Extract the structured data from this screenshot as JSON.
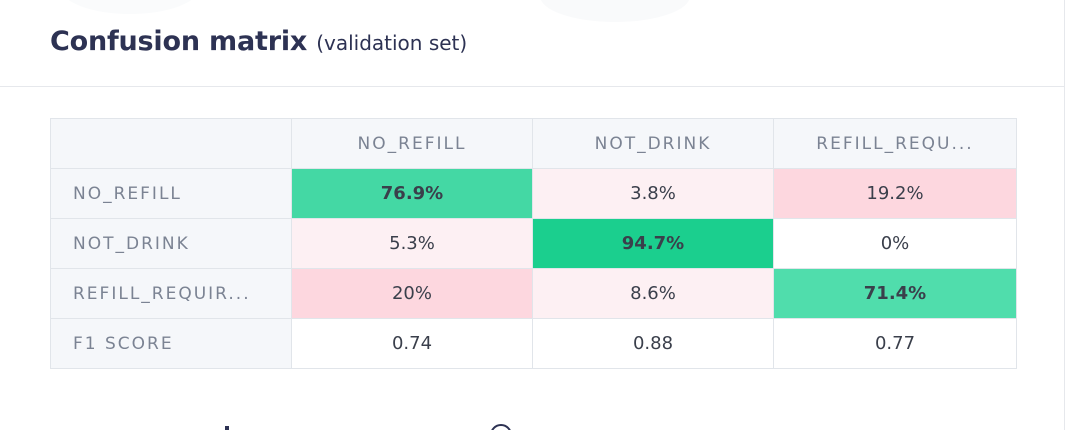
{
  "header": {
    "title": "Confusion matrix",
    "subtitle": "(validation set)"
  },
  "matrix": {
    "columns": [
      "NO_REFILL",
      "NOT_DRINK",
      "REFILL_REQU..."
    ],
    "rows": [
      {
        "label": "NO_REFILL",
        "cells": [
          "76.9%",
          "3.8%",
          "19.2%"
        ]
      },
      {
        "label": "NOT_DRINK",
        "cells": [
          "5.3%",
          "94.7%",
          "0%"
        ]
      },
      {
        "label": "REFILL_REQUIR...",
        "cells": [
          "20%",
          "8.6%",
          "71.4%"
        ]
      }
    ],
    "f1": {
      "label": "F1 SCORE",
      "cells": [
        "0.74",
        "0.88",
        "0.77"
      ]
    }
  },
  "colors": {
    "diagonal_strong": "#1bcf8e",
    "diagonal": "#44d8a4",
    "error_high": "#fdd7df",
    "error_low": "#fdf0f3",
    "title": "#2d3253",
    "label": "#7b8393"
  }
}
